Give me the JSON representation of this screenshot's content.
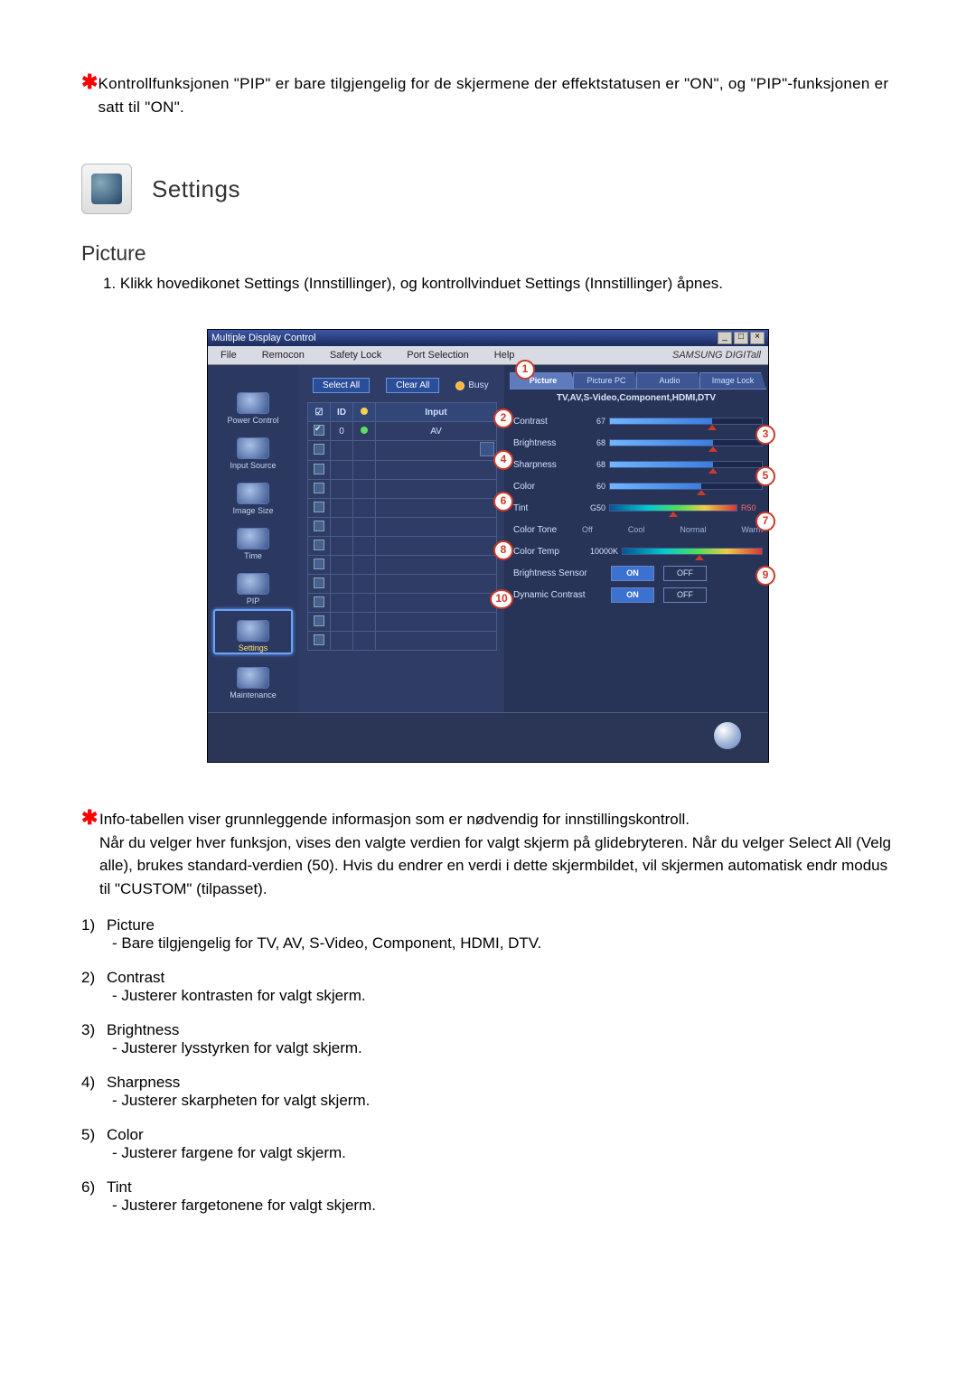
{
  "top_note": "Kontrollfunksjonen \"PIP\" er bare tilgjengelig for de skjermene der effektstatusen er \"ON\", og \"PIP\"-funksjonen er satt til \"ON\".",
  "section_title": "Settings",
  "subsection_title": "Picture",
  "intro": "1. Klikk hovedikonet Settings (Innstillinger), og kontrollvinduet Settings (Innstillinger) åpnes.",
  "app": {
    "title": "Multiple Display Control",
    "menu": [
      "File",
      "Remocon",
      "Safety Lock",
      "Port Selection",
      "Help"
    ],
    "brand": "SAMSUNG DIGITall",
    "nav": [
      "Power Control",
      "Input Source",
      "Image Size",
      "Time",
      "PIP",
      "Settings",
      "Maintenance"
    ],
    "nav_selected": "Settings",
    "select_all": "Select All",
    "clear_all": "Clear All",
    "busy": "Busy",
    "grid_headers": {
      "chk": "",
      "id": "ID",
      "status": "",
      "input": "Input"
    },
    "grid_row": {
      "id": "0",
      "input": "AV"
    },
    "tabs": [
      "Picture",
      "Picture PC",
      "Audio",
      "Image Lock"
    ],
    "tab_active": "Picture",
    "sources_line": "TV,AV,S-Video,Component,HDMI,DTV",
    "rows": {
      "contrast": {
        "label": "Contrast",
        "value": "67"
      },
      "brightness": {
        "label": "Brightness",
        "value": "68"
      },
      "sharpness": {
        "label": "Sharpness",
        "value": "68"
      },
      "color": {
        "label": "Color",
        "value": "60"
      },
      "tint": {
        "label": "Tint",
        "value": "G50",
        "right": "R50"
      },
      "colortone": {
        "label": "Color Tone",
        "opts": [
          "Off",
          "Cool",
          "Normal",
          "Warm"
        ]
      },
      "colortemp": {
        "label": "Color Temp",
        "value": "10000K"
      },
      "brightsensor": {
        "label": "Brightness Sensor"
      },
      "dyncontrast": {
        "label": "Dynamic Contrast"
      }
    },
    "on": "ON",
    "off": "OFF"
  },
  "info_note": "Info-tabellen viser grunnleggende informasjon som er nødvendig for innstillingskontroll.\nNår du velger hver funksjon, vises den valgte verdien for valgt skjerm på glidebryteren. Når du velger Select All (Velg alle), brukes standard-verdien (50). Hvis du endrer en verdi i dette skjermbildet, vil skjermen automatisk endr modus til \"CUSTOM\" (tilpasset).",
  "definitions": [
    {
      "n": "1)",
      "t": "Picture",
      "d": "- Bare tilgjengelig for TV, AV, S-Video, Component, HDMI, DTV."
    },
    {
      "n": "2)",
      "t": "Contrast",
      "d": "- Justerer kontrasten for valgt skjerm."
    },
    {
      "n": "3)",
      "t": "Brightness",
      "d": "- Justerer lysstyrken for valgt skjerm."
    },
    {
      "n": "4)",
      "t": "Sharpness",
      "d": "- Justerer skarpheten for valgt skjerm."
    },
    {
      "n": "5)",
      "t": "Color",
      "d": "- Justerer fargene for valgt skjerm."
    },
    {
      "n": "6)",
      "t": "Tint",
      "d": "- Justerer fargetonene for valgt skjerm."
    }
  ]
}
